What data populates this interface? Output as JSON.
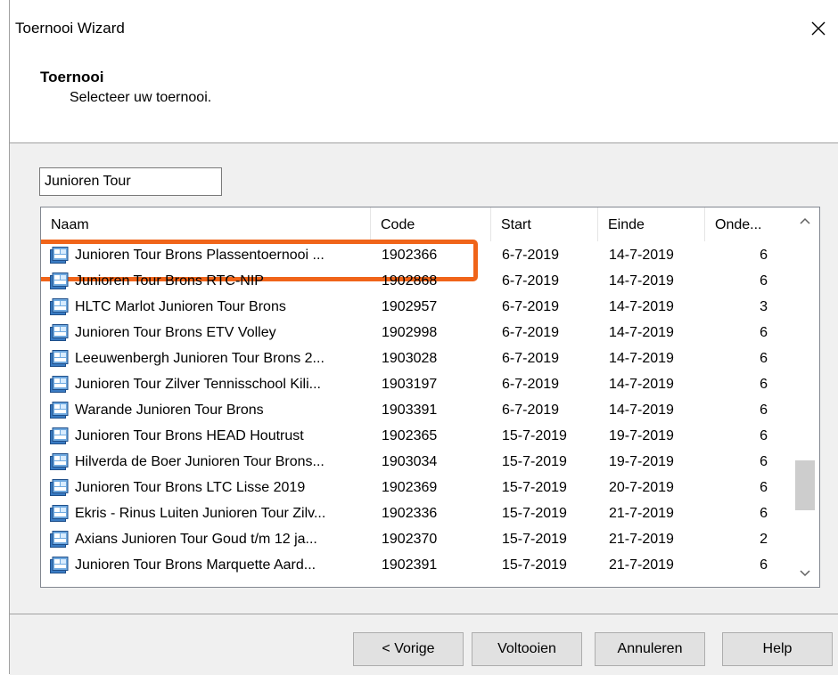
{
  "window": {
    "title": "Toernooi Wizard"
  },
  "header": {
    "title": "Toernooi",
    "subtitle": "Selecteer uw toernooi."
  },
  "search": {
    "value": "Junioren Tour"
  },
  "columns": {
    "naam": "Naam",
    "code": "Code",
    "start": "Start",
    "einde": "Einde",
    "onde": "Onde..."
  },
  "rows": [
    {
      "naam": "Junioren Tour Brons Plassentoernooi ...",
      "code": "1902366",
      "start": "6-7-2019",
      "einde": "14-7-2019",
      "onde": "6"
    },
    {
      "naam": "Junioren Tour Brons RTC-NIP",
      "code": "1902868",
      "start": "6-7-2019",
      "einde": "14-7-2019",
      "onde": "6"
    },
    {
      "naam": "HLTC Marlot Junioren Tour Brons",
      "code": "1902957",
      "start": "6-7-2019",
      "einde": "14-7-2019",
      "onde": "3"
    },
    {
      "naam": "Junioren Tour Brons ETV Volley",
      "code": "1902998",
      "start": "6-7-2019",
      "einde": "14-7-2019",
      "onde": "6"
    },
    {
      "naam": "Leeuwenbergh Junioren Tour Brons 2...",
      "code": "1903028",
      "start": "6-7-2019",
      "einde": "14-7-2019",
      "onde": "6"
    },
    {
      "naam": "Junioren Tour Zilver Tennisschool Kili...",
      "code": "1903197",
      "start": "6-7-2019",
      "einde": "14-7-2019",
      "onde": "6"
    },
    {
      "naam": "Warande Junioren Tour Brons",
      "code": "1903391",
      "start": "6-7-2019",
      "einde": "14-7-2019",
      "onde": "6"
    },
    {
      "naam": "Junioren Tour Brons HEAD Houtrust",
      "code": "1902365",
      "start": "15-7-2019",
      "einde": "19-7-2019",
      "onde": "6"
    },
    {
      "naam": "Hilverda de Boer Junioren Tour Brons...",
      "code": "1903034",
      "start": "15-7-2019",
      "einde": "19-7-2019",
      "onde": "6"
    },
    {
      "naam": "Junioren Tour Brons LTC Lisse 2019",
      "code": "1902369",
      "start": "15-7-2019",
      "einde": "20-7-2019",
      "onde": "6"
    },
    {
      "naam": "Ekris - Rinus Luiten Junioren Tour Zilv...",
      "code": "1902336",
      "start": "15-7-2019",
      "einde": "21-7-2019",
      "onde": "6"
    },
    {
      "naam": "Axians Junioren Tour Goud t/m 12 ja...",
      "code": "1902370",
      "start": "15-7-2019",
      "einde": "21-7-2019",
      "onde": "2"
    },
    {
      "naam": "Junioren Tour Brons Marquette Aard...",
      "code": "1902391",
      "start": "15-7-2019",
      "einde": "21-7-2019",
      "onde": "6"
    }
  ],
  "buttons": {
    "prev": "< Vorige",
    "finish": "Voltooien",
    "cancel": "Annuleren",
    "help": "Help"
  },
  "colors": {
    "highlight": "#f06419",
    "face": "#f0f0f0"
  },
  "icons": {
    "row": "tournament-icon",
    "close": "close-icon",
    "up": "scroll-up-icon",
    "down": "scroll-down-icon"
  },
  "scroll": {
    "position_fraction": 0.82
  }
}
